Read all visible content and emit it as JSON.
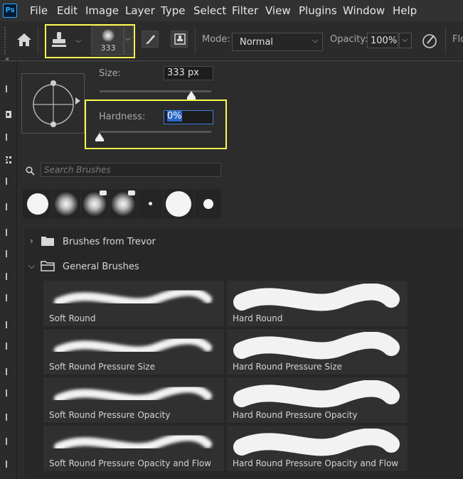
{
  "app": {
    "logo": "Ps"
  },
  "menu": [
    "File",
    "Edit",
    "Image",
    "Layer",
    "Type",
    "Select",
    "Filter",
    "View",
    "Plugins",
    "Window",
    "Help"
  ],
  "options_bar": {
    "brush_size_preview": "333",
    "mode_label": "Mode:",
    "mode_value": "Normal",
    "opacity_label": "Opacity:",
    "opacity_value": "100%",
    "flow_label": "Flo"
  },
  "brush_panel": {
    "size_label": "Size:",
    "size_value": "333 px",
    "size_slider_fraction": 0.82,
    "hardness_label": "Hardness:",
    "hardness_value": "0%",
    "hardness_slider_fraction": 0.0,
    "search_placeholder": "Search Brushes"
  },
  "folders": [
    {
      "name": "Brushes from Trevor",
      "expanded": false
    },
    {
      "name": "General Brushes",
      "expanded": true
    }
  ],
  "brushes": [
    {
      "name": "Soft Round",
      "style": "soft"
    },
    {
      "name": "Hard Round",
      "style": "hard"
    },
    {
      "name": "Soft Round Pressure Size",
      "style": "soft"
    },
    {
      "name": "Hard Round Pressure Size",
      "style": "hard"
    },
    {
      "name": "Soft Round Pressure Opacity",
      "style": "soft"
    },
    {
      "name": "Hard Round Pressure Opacity",
      "style": "hard"
    },
    {
      "name": "Soft Round Pressure Opacity and Flow",
      "style": "soft"
    },
    {
      "name": "Hard Round Pressure Opacity and Flow",
      "style": "hard"
    }
  ],
  "colors": {
    "highlight": "#fffb4d",
    "selection": "#2a66c4"
  }
}
